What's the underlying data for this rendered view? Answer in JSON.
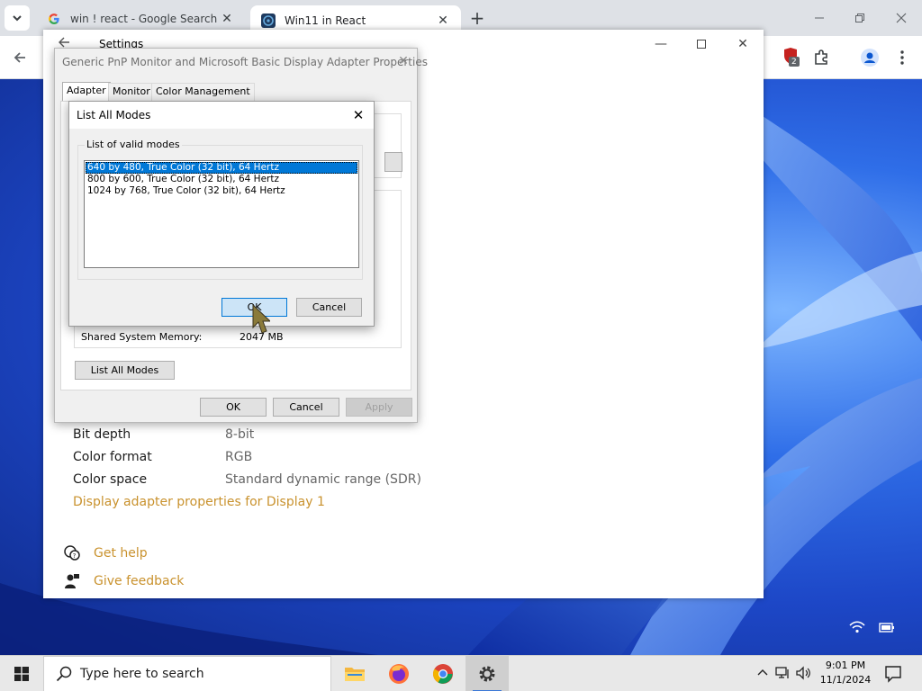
{
  "browser": {
    "tabs": [
      {
        "title": "win ! react - Google Search",
        "favicon": "google-g-icon",
        "active": false
      },
      {
        "title": "Win11 in React",
        "favicon": "react-app-icon",
        "active": true
      }
    ],
    "extension_badge": "2"
  },
  "settings": {
    "title": "Settings",
    "rows": [
      {
        "label": "Bit depth",
        "value": "8-bit"
      },
      {
        "label": "Color format",
        "value": "RGB"
      },
      {
        "label": "Color space",
        "value": "Standard dynamic range (SDR)"
      }
    ],
    "adapter_link": "Display adapter properties for Display 1",
    "get_help": "Get help",
    "give_feedback": "Give feedback"
  },
  "properties": {
    "title": "Generic PnP Monitor and Microsoft Basic Display Adapter Properties",
    "tabs": [
      "Adapter",
      "Monitor",
      "Color Management"
    ],
    "shared_memory_label": "Shared System Memory:",
    "shared_memory_value": "2047 MB",
    "list_all_modes": "List All Modes",
    "ok": "OK",
    "cancel": "Cancel",
    "apply": "Apply"
  },
  "modes_dialog": {
    "title": "List All Modes",
    "group_label": "List of valid modes",
    "modes": [
      "640 by 480, True Color (32 bit), 64 Hertz",
      "800 by 600, True Color (32 bit), 64 Hertz",
      "1024 by 768, True Color (32 bit), 64 Hertz"
    ],
    "selected_index": 0,
    "ok": "OK",
    "cancel": "Cancel"
  },
  "taskbar": {
    "search_placeholder": "Type here to search",
    "apps": [
      "file-explorer-icon",
      "firefox-icon",
      "chrome-icon",
      "settings-gear-icon"
    ],
    "time": "9:01 PM",
    "date": "11/1/2024"
  },
  "colors": {
    "accent": "#0078d7",
    "link": "#c9922e",
    "taskbar": "#e8e8e8"
  }
}
